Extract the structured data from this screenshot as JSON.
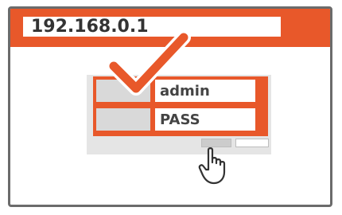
{
  "browser": {
    "address": "192.168.0.1"
  },
  "login": {
    "username_value": "admin",
    "password_value": "PASS"
  },
  "colors": {
    "accent": "#e8582a",
    "frame": "#6b6b6b",
    "panel": "#e5e5e5"
  },
  "icons": [
    "checkmark-icon",
    "hand-pointer-icon"
  ]
}
